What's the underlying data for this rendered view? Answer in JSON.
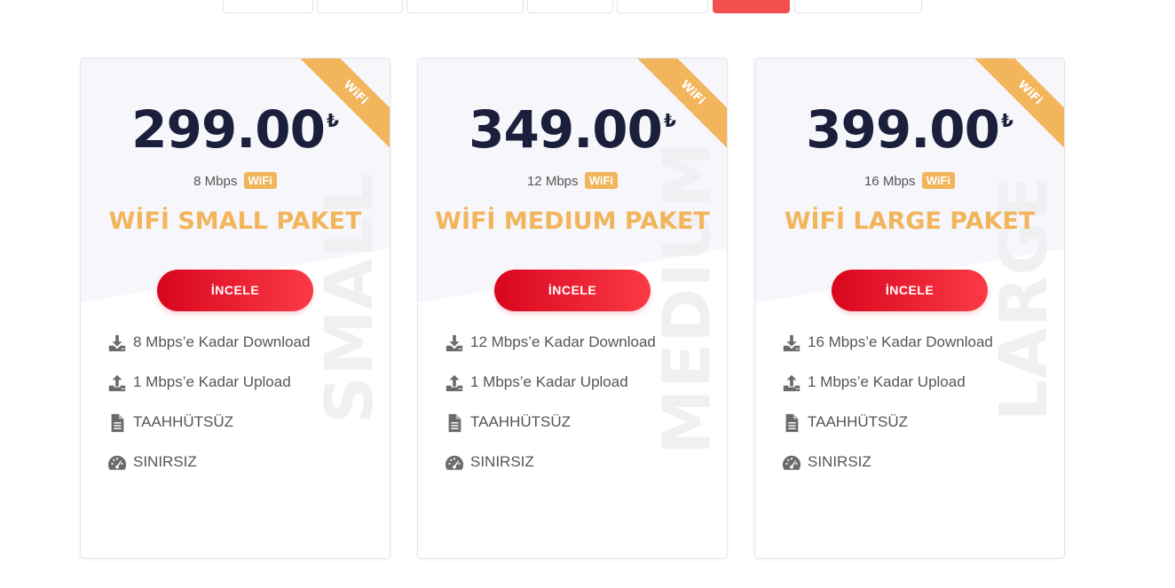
{
  "tabs": {
    "count": 7,
    "active_index": 5
  },
  "colors": {
    "accent_orange": "#f2b55c",
    "button_red": "#d8061e",
    "price_navy": "#1b1f3b"
  },
  "cards": [
    {
      "ribbon": "WiFi",
      "watermark": "SMALL",
      "price": "299.00",
      "currency": "₺",
      "speed": "8 Mbps",
      "badge": "WiFi",
      "name": "WİFİ SMALL PAKET",
      "button": "İNCELE",
      "features": [
        {
          "icon": "download-icon",
          "text": "8 Mbps’e Kadar Download"
        },
        {
          "icon": "upload-icon",
          "text": "1 Mbps’e Kadar Upload"
        },
        {
          "icon": "document-icon",
          "text": "TAAHHÜTSÜZ"
        },
        {
          "icon": "speedometer-icon",
          "text": "SINIRSIZ"
        }
      ]
    },
    {
      "ribbon": "WiFi",
      "watermark": "MEDIUM",
      "price": "349.00",
      "currency": "₺",
      "speed": "12 Mbps",
      "badge": "WiFi",
      "name": "WİFİ MEDIUM PAKET",
      "button": "İNCELE",
      "features": [
        {
          "icon": "download-icon",
          "text": "12 Mbps’e Kadar Download"
        },
        {
          "icon": "upload-icon",
          "text": "1 Mbps’e Kadar Upload"
        },
        {
          "icon": "document-icon",
          "text": "TAAHHÜTSÜZ"
        },
        {
          "icon": "speedometer-icon",
          "text": "SINIRSIZ"
        }
      ]
    },
    {
      "ribbon": "WiFi",
      "watermark": "LARGE",
      "price": "399.00",
      "currency": "₺",
      "speed": "16 Mbps",
      "badge": "WiFi",
      "name": "WİFİ LARGE PAKET",
      "button": "İNCELE",
      "features": [
        {
          "icon": "download-icon",
          "text": "16 Mbps’e Kadar Download"
        },
        {
          "icon": "upload-icon",
          "text": "1 Mbps’e Kadar Upload"
        },
        {
          "icon": "document-icon",
          "text": "TAAHHÜTSÜZ"
        },
        {
          "icon": "speedometer-icon",
          "text": "SINIRSIZ"
        }
      ]
    }
  ]
}
